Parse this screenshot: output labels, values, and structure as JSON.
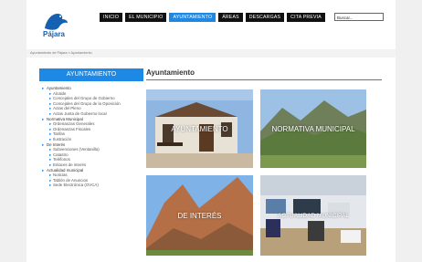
{
  "logo": {
    "name": "Pájara"
  },
  "nav": {
    "items": [
      "INICIO",
      "EL MUNICIPIO",
      "AYUNTAMIENTO",
      "ÁREAS",
      "DESCARGAS",
      "CITA PREVIA"
    ],
    "search_placeholder": "Buscar..."
  },
  "breadcrumb": "Ayuntamiento de Pájara » Ayuntamiento",
  "sidebar": {
    "title": "AYUNTAMIENTO",
    "items": [
      {
        "label": "Ayuntamiento",
        "level": 0
      },
      {
        "label": "Alcalde",
        "level": 1
      },
      {
        "label": "Concejales del Grupo de Gobierno",
        "level": 1
      },
      {
        "label": "Concejales del Grupo de la Oposición",
        "level": 1
      },
      {
        "label": "Actas del Pleno",
        "level": 1
      },
      {
        "label": "Actas Junta de Gobierno local",
        "level": 1
      },
      {
        "label": "Normativa Municipal",
        "level": 0
      },
      {
        "label": "Ordenanzas Generales",
        "level": 1
      },
      {
        "label": "Ordenanzas Fiscales",
        "level": 1
      },
      {
        "label": "Tarifas",
        "level": 1
      },
      {
        "label": "Ilustración",
        "level": 1
      },
      {
        "label": "De Interés",
        "level": 0
      },
      {
        "label": "Subvenciones (Ventanilla)",
        "level": 1
      },
      {
        "label": "Catastro",
        "level": 1
      },
      {
        "label": "Teléfonos",
        "level": 1
      },
      {
        "label": "Enlaces de interés",
        "level": 1
      },
      {
        "label": "Actualidad municipal",
        "level": 0
      },
      {
        "label": "Noticias",
        "level": 1
      },
      {
        "label": "Tablón de Anuncios",
        "level": 1
      },
      {
        "label": "Sede Electrónica (OVCA)",
        "level": 1
      }
    ]
  },
  "main": {
    "title": "Ayuntamiento",
    "tiles": [
      {
        "label": "AYUNTAMIENTO"
      },
      {
        "label": "NORMATIVA MUNICIPAL"
      },
      {
        "label": "DE INTERÉS"
      },
      {
        "label": "ACTUALIDAD MUNICIPAL"
      }
    ]
  },
  "colors": {
    "accent": "#1e88e5",
    "nav_bg": "#111111"
  }
}
